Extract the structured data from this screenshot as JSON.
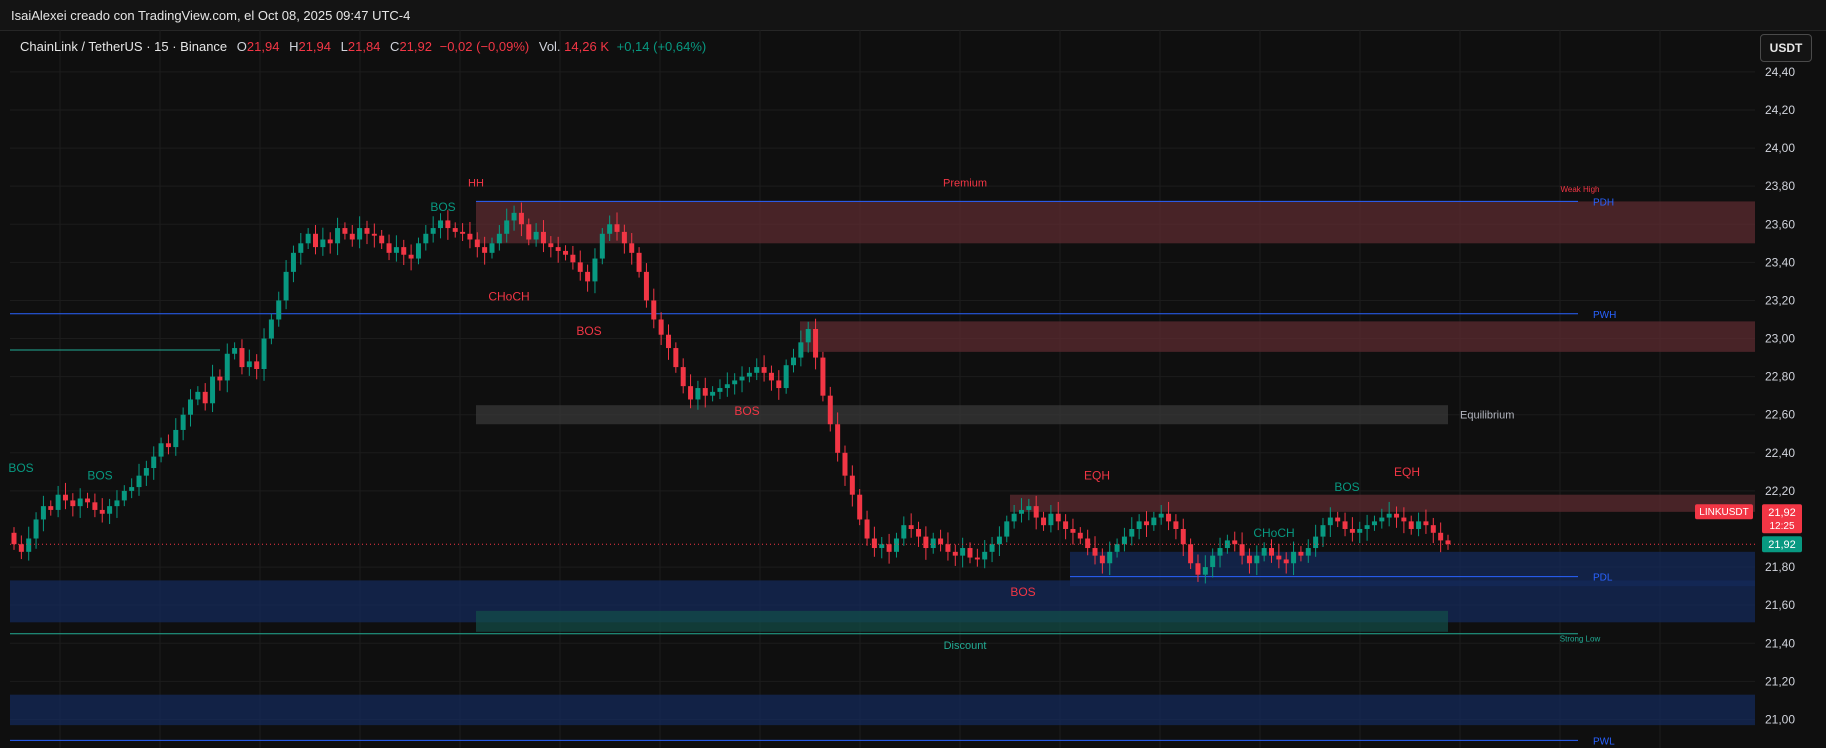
{
  "header": {
    "attribution": "IsaiAlexei creado con TradingView.com, el Oct 08, 2025 09:47 UTC-4"
  },
  "legend": {
    "symbol": "ChainLink / TetherUS · 15 · Binance",
    "o_label": "O",
    "o_value": "21,94",
    "h_label": "H",
    "h_value": "21,94",
    "l_label": "L",
    "l_value": "21,84",
    "c_label": "C",
    "c_value": "21,92",
    "change": "−0,02 (−0,09%)",
    "vol_label": "Vol.",
    "vol_value": "14,26 K",
    "vol_change": "+0,14 (+0,64%)"
  },
  "currency_button": "USDT",
  "colors": {
    "background": "#0f0f0f",
    "bull": "#089981",
    "bear": "#f23645",
    "line_blue": "#2962ff",
    "line_green": "#22ab94",
    "premium_zone": "#5c2b30",
    "discount_zone": "#142a5a",
    "equilibrium_zone": "#3a3a3a"
  },
  "chart_data": {
    "type": "candlestick",
    "symbol": "LINKUSDT",
    "timeframe": "15",
    "y_range": [
      20.85,
      24.62
    ],
    "y_ticks": [
      "24,40",
      "24,20",
      "24,00",
      "23,80",
      "23,60",
      "23,40",
      "23,20",
      "23,00",
      "22,80",
      "22,60",
      "22,40",
      "22,20",
      "21,80",
      "21,60",
      "21,40",
      "21,20",
      "21,00"
    ],
    "last_price": {
      "symbol_label": "LINKUSDT",
      "price": "21,92",
      "countdown": "12:25",
      "price_green": "21,92",
      "value": 21.92
    },
    "series_close": [
      21.92,
      21.88,
      21.95,
      22.05,
      22.12,
      22.1,
      22.18,
      22.15,
      22.12,
      22.16,
      22.14,
      22.1,
      22.08,
      22.12,
      22.15,
      22.2,
      22.22,
      22.28,
      22.32,
      22.38,
      22.45,
      22.43,
      22.52,
      22.6,
      22.68,
      22.72,
      22.66,
      22.8,
      22.78,
      22.92,
      22.95,
      22.85,
      22.88,
      22.84,
      23.0,
      23.1,
      23.2,
      23.35,
      23.45,
      23.5,
      23.55,
      23.48,
      23.52,
      23.5,
      23.58,
      23.55,
      23.52,
      23.58,
      23.55,
      23.54,
      23.5,
      23.45,
      23.48,
      23.44,
      23.42,
      23.5,
      23.55,
      23.58,
      23.62,
      23.58,
      23.56,
      23.55,
      23.52,
      23.48,
      23.45,
      23.5,
      23.55,
      23.62,
      23.66,
      23.6,
      23.52,
      23.56,
      23.5,
      23.48,
      23.46,
      23.44,
      23.4,
      23.35,
      23.3,
      23.42,
      23.55,
      23.6,
      23.56,
      23.5,
      23.45,
      23.35,
      23.2,
      23.1,
      23.02,
      22.95,
      22.85,
      22.75,
      22.68,
      22.74,
      22.7,
      22.72,
      22.74,
      22.76,
      22.78,
      22.8,
      22.82,
      22.85,
      22.82,
      22.78,
      22.74,
      22.86,
      22.9,
      22.98,
      23.05,
      22.9,
      22.7,
      22.55,
      22.4,
      22.28,
      22.18,
      22.05,
      21.95,
      21.9,
      21.92,
      21.88,
      21.95,
      22.02,
      22.0,
      21.96,
      21.9,
      21.95,
      21.92,
      21.88,
      21.86,
      21.9,
      21.85,
      21.84,
      21.88,
      21.92,
      21.96,
      22.04,
      22.08,
      22.1,
      22.12,
      22.06,
      22.02,
      22.08,
      22.04,
      22.0,
      21.98,
      21.95,
      21.9,
      21.86,
      21.82,
      21.88,
      21.92,
      21.96,
      22.0,
      22.04,
      22.02,
      22.06,
      22.08,
      22.04,
      22.0,
      21.92,
      21.82,
      21.76,
      21.8,
      21.86,
      21.9,
      21.94,
      21.92,
      21.86,
      21.82,
      21.86,
      21.9,
      21.86,
      21.84,
      21.82,
      21.88,
      21.86,
      21.9,
      21.96,
      22.02,
      22.06,
      22.04,
      22.0,
      21.98,
      22.0,
      22.02,
      22.04,
      22.06,
      22.08,
      22.06,
      22.04,
      22.0,
      22.04,
      22.02,
      21.98,
      21.94,
      21.92
    ],
    "series_open": [
      21.98,
      21.92,
      21.88,
      21.95,
      22.05,
      22.12,
      22.1,
      22.18,
      22.15,
      22.12,
      22.16,
      22.14,
      22.1,
      22.08,
      22.12,
      22.15,
      22.2,
      22.22,
      22.28,
      22.32,
      22.38,
      22.45,
      22.43,
      22.52,
      22.6,
      22.68,
      22.72,
      22.66,
      22.8,
      22.78,
      22.92,
      22.95,
      22.85,
      22.88,
      22.84,
      23.0,
      23.1,
      23.2,
      23.35,
      23.45,
      23.5,
      23.55,
      23.48,
      23.52,
      23.5,
      23.58,
      23.55,
      23.52,
      23.58,
      23.55,
      23.54,
      23.5,
      23.45,
      23.48,
      23.44,
      23.42,
      23.5,
      23.55,
      23.58,
      23.62,
      23.58,
      23.56,
      23.55,
      23.52,
      23.48,
      23.45,
      23.5,
      23.55,
      23.62,
      23.66,
      23.6,
      23.52,
      23.56,
      23.5,
      23.48,
      23.46,
      23.44,
      23.4,
      23.35,
      23.3,
      23.42,
      23.55,
      23.6,
      23.56,
      23.5,
      23.45,
      23.35,
      23.2,
      23.1,
      23.02,
      22.95,
      22.85,
      22.75,
      22.68,
      22.74,
      22.7,
      22.72,
      22.74,
      22.76,
      22.78,
      22.8,
      22.82,
      22.85,
      22.82,
      22.78,
      22.74,
      22.86,
      22.9,
      22.98,
      23.05,
      22.9,
      22.7,
      22.55,
      22.4,
      22.28,
      22.18,
      22.05,
      21.95,
      21.9,
      21.92,
      21.88,
      21.95,
      22.02,
      22.0,
      21.96,
      21.9,
      21.95,
      21.92,
      21.88,
      21.86,
      21.9,
      21.85,
      21.84,
      21.88,
      21.92,
      21.96,
      22.04,
      22.08,
      22.1,
      22.12,
      22.06,
      22.02,
      22.08,
      22.04,
      22.0,
      21.98,
      21.95,
      21.9,
      21.86,
      21.82,
      21.88,
      21.92,
      21.96,
      22.0,
      22.04,
      22.02,
      22.06,
      22.08,
      22.04,
      22.0,
      21.92,
      21.82,
      21.76,
      21.8,
      21.86,
      21.9,
      21.94,
      21.92,
      21.86,
      21.82,
      21.86,
      21.9,
      21.86,
      21.84,
      21.82,
      21.88,
      21.86,
      21.9,
      21.96,
      22.02,
      22.06,
      22.04,
      22.0,
      21.98,
      22.0,
      22.02,
      22.04,
      22.06,
      22.08,
      22.06,
      22.04,
      22.0,
      22.04,
      22.02,
      21.98,
      21.94
    ],
    "zones": [
      {
        "name": "premium-upper",
        "kind": "premium",
        "y_top": 23.72,
        "y_bottom": 23.5
      },
      {
        "name": "premium-mid",
        "kind": "premium",
        "y_top": 23.09,
        "y_bottom": 22.93
      },
      {
        "name": "equilibrium",
        "kind": "equilibrium",
        "y_top": 22.65,
        "y_bottom": 22.55
      },
      {
        "name": "supply-right",
        "kind": "premium",
        "y_top": 22.18,
        "y_bottom": 22.09
      },
      {
        "name": "discount-upper",
        "kind": "discount",
        "y_top": 21.88,
        "y_bottom": 21.7
      },
      {
        "name": "discount-lower",
        "kind": "discount",
        "y_top": 21.73,
        "y_bottom": 21.51
      },
      {
        "name": "discount-teal",
        "kind": "discount_teal",
        "y_top": 21.57,
        "y_bottom": 21.46
      },
      {
        "name": "discount-bottom",
        "kind": "discount",
        "y_top": 21.13,
        "y_bottom": 20.97
      }
    ],
    "levels": [
      {
        "label": "PDH",
        "value": 23.72,
        "color": "#2962ff"
      },
      {
        "label": "PWH",
        "value": 23.13,
        "color": "#2962ff"
      },
      {
        "label": "PDL",
        "value": 21.75,
        "color": "#2962ff"
      },
      {
        "label": "PWL",
        "value": 20.89,
        "color": "#2962ff"
      },
      {
        "label": "",
        "value": 22.94,
        "color": "#22ab94"
      },
      {
        "label": "",
        "value": 21.45,
        "color": "#22ab94"
      }
    ],
    "annotations": [
      {
        "text": "Premium",
        "color": "#f23645",
        "value": 23.82
      },
      {
        "text": "Weak High",
        "color": "#f23645",
        "value": 23.79
      },
      {
        "text": "HH",
        "color": "#f23645",
        "value": 23.82
      },
      {
        "text": "BOS",
        "color": "#089981",
        "value": 23.69
      },
      {
        "text": "CHoCH",
        "color": "#f23645",
        "value": 23.22
      },
      {
        "text": "BOS",
        "color": "#f23645",
        "value": 23.04
      },
      {
        "text": "Equilibrium",
        "color": "#b2b5be",
        "value": 22.6
      },
      {
        "text": "BOS",
        "color": "#f23645",
        "value": 22.62
      },
      {
        "text": "EQH",
        "color": "#f23645",
        "value": 22.28
      },
      {
        "text": "BOS",
        "color": "#089981",
        "value": 22.22
      },
      {
        "text": "EQH",
        "color": "#f23645",
        "value": 22.3
      },
      {
        "text": "CHoCH",
        "color": "#089981",
        "value": 21.98
      },
      {
        "text": "BOS",
        "color": "#f23645",
        "value": 21.67
      },
      {
        "text": "Discount",
        "color": "#22ab94",
        "value": 21.39
      },
      {
        "text": "Strong Low",
        "color": "#22ab94",
        "value": 21.43
      },
      {
        "text": "BOS",
        "color": "#089981",
        "value": 22.28
      },
      {
        "text": "BOS",
        "color": "#089981",
        "value": 22.32
      }
    ]
  }
}
